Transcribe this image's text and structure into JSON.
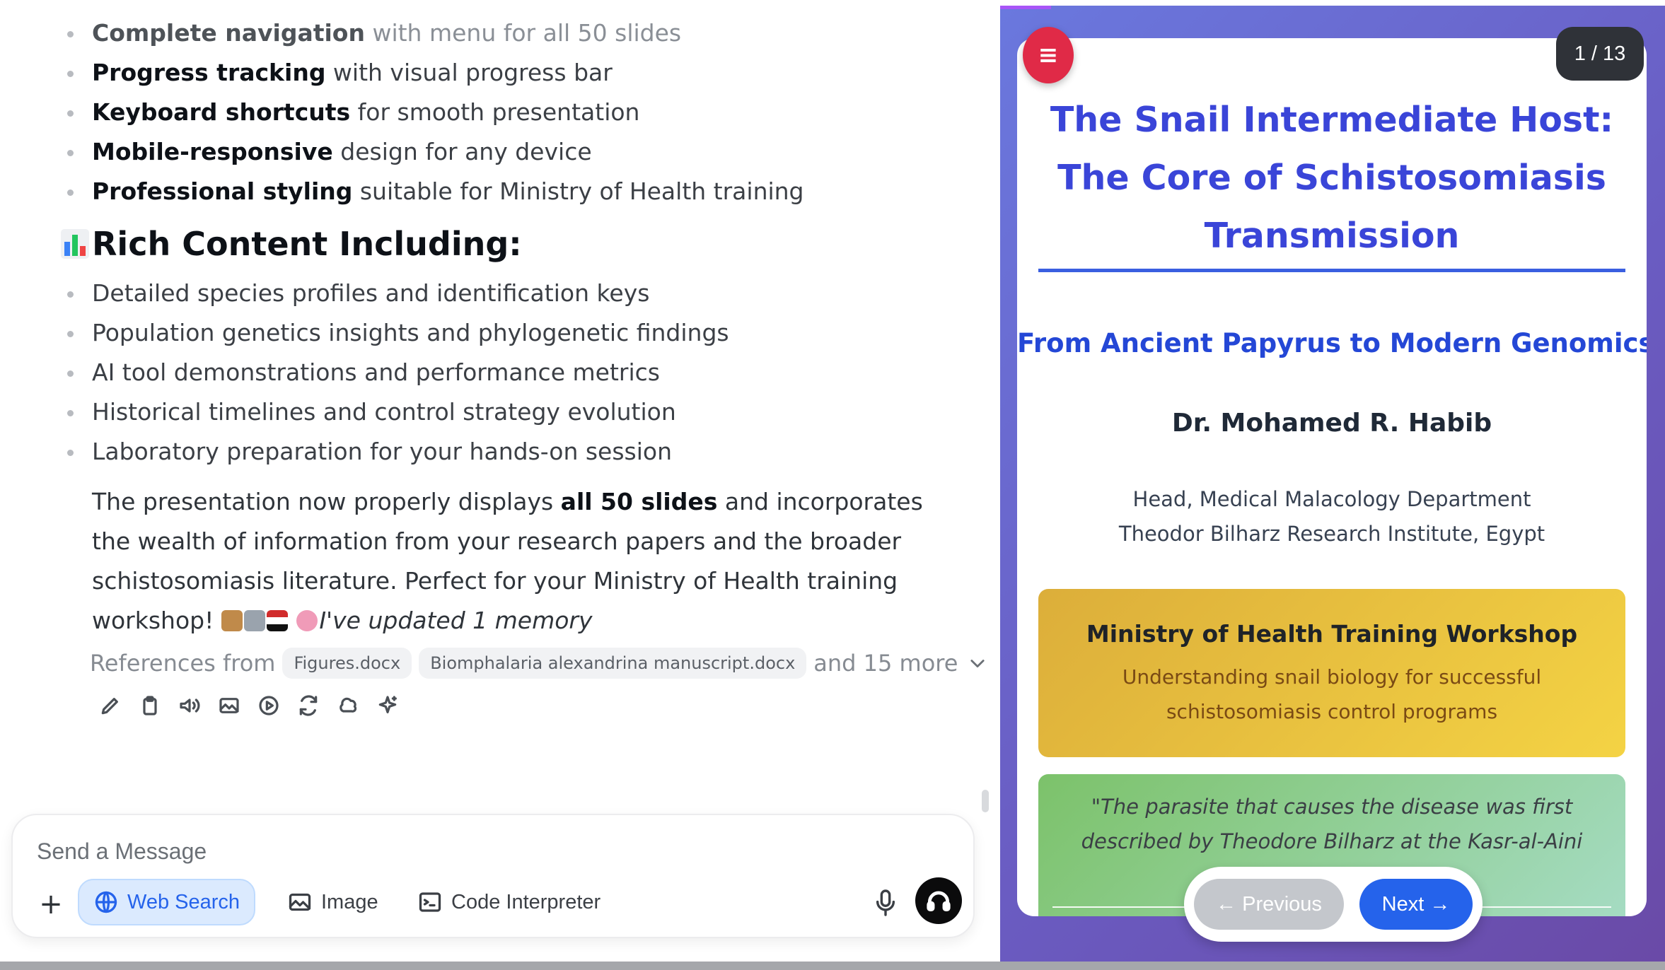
{
  "chat": {
    "features": [
      {
        "bold": "Complete navigation",
        "rest": " with menu for all 50 slides"
      },
      {
        "bold": "Progress tracking",
        "rest": " with visual progress bar"
      },
      {
        "bold": "Keyboard shortcuts",
        "rest": " for smooth presentation"
      },
      {
        "bold": "Mobile-responsive",
        "rest": " design for any device"
      },
      {
        "bold": "Professional styling",
        "rest": " suitable for Ministry of Health training"
      }
    ],
    "rich_heading": "Rich Content Including:",
    "content_items": [
      "Detailed species profiles and identification keys",
      "Population genetics insights and phylogenetic findings",
      "AI tool demonstrations and performance metrics",
      "Historical timelines and control strategy evolution",
      "Laboratory preparation for your hands-on session"
    ],
    "summary": {
      "before": "The presentation now properly displays ",
      "bold": "all 50 slides",
      "after": " and incorporates the wealth of information from your research papers and the broader schistosomiasis literature. Perfect for your Ministry of Health training workshop! ",
      "memory": "I've updated 1 memory"
    },
    "references": {
      "label": "References from",
      "chips": [
        "Figures.docx",
        "Biomphalaria alexandrina manuscript.docx"
      ],
      "more": "and 15 more"
    },
    "action_icons": [
      "edit-icon",
      "copy-icon",
      "read-aloud-icon",
      "image-icon",
      "play-icon",
      "regenerate-icon",
      "memory-icon",
      "sparkle-icon"
    ]
  },
  "composer": {
    "placeholder": "Send a Message",
    "tools": {
      "web_search": "Web Search",
      "image": "Image",
      "code_interpreter": "Code Interpreter"
    }
  },
  "slide": {
    "counter": "1 / 13",
    "title": "The Snail Intermediate Host: The Core of Schistosomiasis Transmission",
    "subtitle": "From Ancient Papyrus to Modern Genomics",
    "author": "Dr. Mohamed R. Habib",
    "affiliation_line1": "Head, Medical Malacology Department",
    "affiliation_line2": "Theodor Bilharz Research Institute, Egypt",
    "workshop_title": "Ministry of Health Training Workshop",
    "workshop_text": "Understanding snail biology for successful schistosomiasis control programs",
    "quote": "\"The parasite that causes the disease was first described by Theodore Bilharz at the Kasr-al-Aini hospital in Cairo in",
    "prev_label": "← Previous",
    "next_label": "Next →"
  },
  "colors": {
    "accent_blue": "#2563eb",
    "title_blue": "#3a45d8",
    "menu_red": "#e02a47",
    "workshop_gold": "#f4d344",
    "quote_green": "#7cc26a",
    "preview_purple": "#6a5cc2"
  }
}
